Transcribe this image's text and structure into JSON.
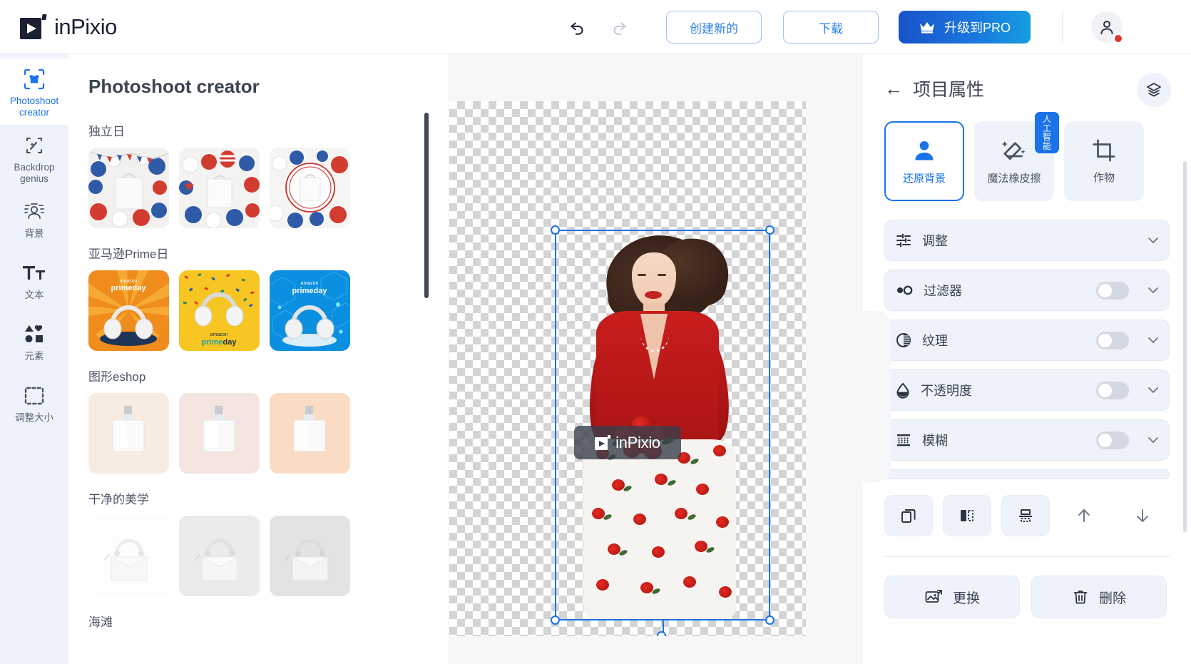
{
  "app": {
    "brand": "inPixio",
    "logo_icon": "play-square-logo-icon"
  },
  "topbar": {
    "undo_icon": "undo-arrow-icon",
    "redo_icon": "redo-arrow-icon",
    "create_new_label": "创建新的",
    "download_label": "下载",
    "upgrade_label": "升级到PRO",
    "upgrade_icon": "crown-icon",
    "avatar_icon": "user-avatar-icon",
    "avatar_badge_color": "#e0352c",
    "accent_blue": "#1a73e8"
  },
  "rail": {
    "items": [
      {
        "label": "Photoshoot creator",
        "icon": "tshirt-frame-icon",
        "active": true
      },
      {
        "label": "Backdrop genius",
        "icon": "magic-frame-icon",
        "active": false
      },
      {
        "label": "背景",
        "icon": "background-person-icon",
        "active": false
      },
      {
        "label": "文本",
        "icon": "text-tt-icon",
        "active": false
      },
      {
        "label": "元素",
        "icon": "shapes-icon",
        "active": false
      },
      {
        "label": "调整大小",
        "icon": "resize-dashed-icon",
        "active": false
      }
    ]
  },
  "panel": {
    "title": "Photoshoot creator",
    "groups": [
      {
        "title": "独立日",
        "thumbs": [
          {
            "name": "independence-day-bunting-bag"
          },
          {
            "name": "independence-day-flag-balloons-bag"
          },
          {
            "name": "independence-day-circle-bag"
          }
        ]
      },
      {
        "title": "亚马逊Prime日",
        "thumbs": [
          {
            "name": "primeday-orange-headphones"
          },
          {
            "name": "primeday-yellow-confetti-headphones"
          },
          {
            "name": "primeday-blue-tech-headphones"
          }
        ]
      },
      {
        "title": "图形eshop",
        "thumbs": [
          {
            "name": "eshop-perfume-cream"
          },
          {
            "name": "eshop-perfume-blush"
          },
          {
            "name": "eshop-perfume-peach"
          }
        ]
      },
      {
        "title": "干净的美学",
        "thumbs": [
          {
            "name": "clean-handbag-white"
          },
          {
            "name": "clean-handbag-light-grey"
          },
          {
            "name": "clean-handbag-grey"
          }
        ]
      },
      {
        "title": "海滩",
        "thumbs": []
      }
    ]
  },
  "canvas": {
    "collapse_left_icon": "chevron-left-icon",
    "collapse_right_icon": "chevron-right-icon",
    "selection": {
      "handle_icon": "resize-handle-icon",
      "rotate_handle_icon": "rotate-handle-icon",
      "border_color": "#1a73e8"
    },
    "watermark_text": "inPixio",
    "subject_name": "woman-in-red-jacket-with-roses"
  },
  "right": {
    "back_icon": "back-arrow-icon",
    "title": "项目属性",
    "layers_icon": "layers-icon",
    "tool_cards": [
      {
        "label": "还原背景",
        "icon": "person-icon",
        "active": true,
        "badge": ""
      },
      {
        "label": "魔法橡皮擦",
        "icon": "magic-eraser-icon",
        "active": false,
        "badge": "人工智能"
      },
      {
        "label": "作物",
        "icon": "crop-icon",
        "active": false,
        "badge": ""
      }
    ],
    "properties": [
      {
        "label": "调整",
        "icon": "sliders-icon",
        "has_toggle": false,
        "toggle_on": false,
        "chevron": "chevron-down-icon"
      },
      {
        "label": "过滤器",
        "icon": "filter-circles-icon",
        "has_toggle": true,
        "toggle_on": false,
        "chevron": "chevron-down-icon"
      },
      {
        "label": "纹理",
        "icon": "texture-contrast-icon",
        "has_toggle": true,
        "toggle_on": false,
        "chevron": "chevron-down-icon"
      },
      {
        "label": "不透明度",
        "icon": "opacity-droplet-icon",
        "has_toggle": true,
        "toggle_on": false,
        "chevron": "chevron-down-icon"
      },
      {
        "label": "模糊",
        "icon": "blur-icon",
        "has_toggle": true,
        "toggle_on": false,
        "chevron": "chevron-down-icon"
      }
    ],
    "actions": [
      {
        "name": "duplicate-button",
        "icon": "duplicate-icon"
      },
      {
        "name": "flip-horizontal-button",
        "icon": "flip-horizontal-icon"
      },
      {
        "name": "flip-vertical-button",
        "icon": "flip-vertical-icon"
      },
      {
        "name": "bring-forward-button",
        "icon": "arrow-up-icon"
      },
      {
        "name": "send-backward-button",
        "icon": "arrow-down-icon"
      }
    ],
    "bottom_buttons": [
      {
        "label": "更换",
        "icon": "replace-image-icon"
      },
      {
        "label": "删除",
        "icon": "trash-icon"
      }
    ]
  }
}
